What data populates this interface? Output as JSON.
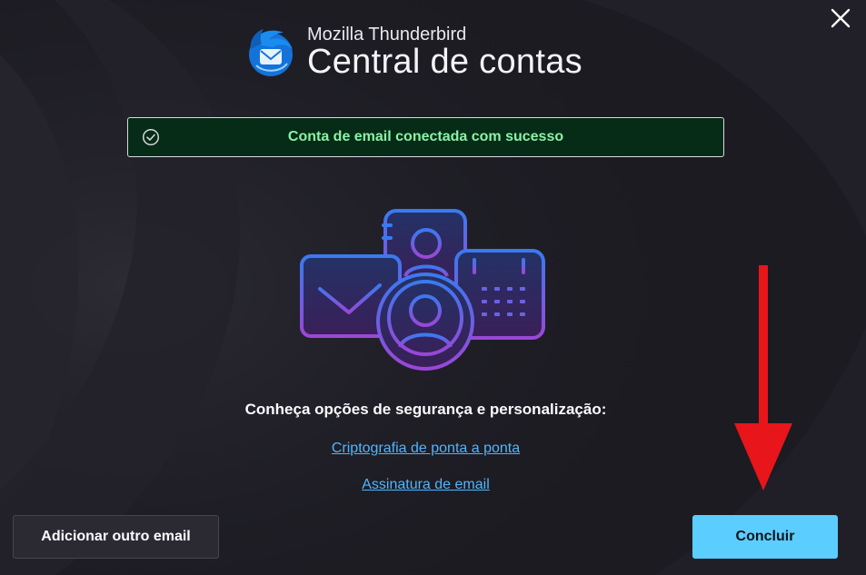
{
  "header": {
    "brand_name": "Mozilla Thunderbird",
    "title": "Central de contas"
  },
  "banner": {
    "message": "Conta de email conectada com sucesso",
    "icon": "check-circle-icon"
  },
  "security": {
    "heading": "Conheça opções de segurança e personalização:",
    "links": [
      "Criptografia de ponta a ponta",
      "Assinatura de email"
    ]
  },
  "footer": {
    "secondary_label": "Adicionar outro email",
    "primary_label": "Concluir"
  },
  "colors": {
    "background": "#1c1b22",
    "accent": "#5bcdff",
    "success_bg": "#062c17",
    "success_text": "#8af2a6",
    "link": "#4fb6ff",
    "annotation_arrow": "#e8151b"
  }
}
